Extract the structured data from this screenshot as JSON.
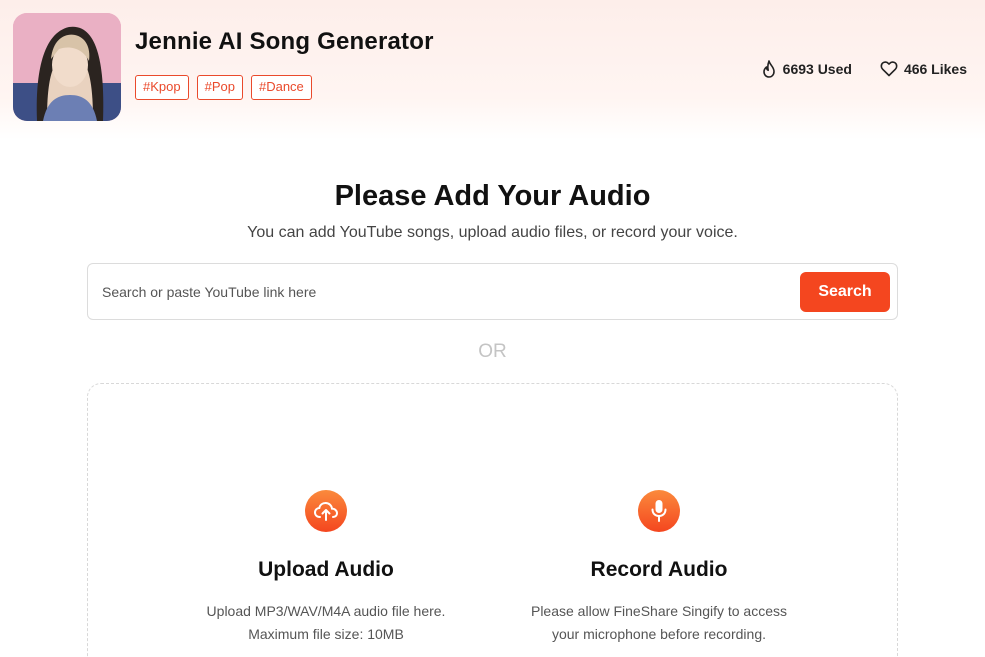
{
  "header": {
    "title": "Jennie AI Song Generator",
    "tags": [
      "#Kpop",
      "#Pop",
      "#Dance"
    ],
    "stats": {
      "used": "6693 Used",
      "likes": "466 Likes"
    },
    "icons": {
      "used": "flame-icon",
      "likes": "heart-icon"
    }
  },
  "main": {
    "title": "Please Add Your Audio",
    "subtitle": "You can add YouTube songs, upload audio files, or record your voice.",
    "search": {
      "placeholder": "Search or paste YouTube link here",
      "value": "",
      "button": "Search"
    },
    "or_label": "OR",
    "options": {
      "upload": {
        "icon": "cloud-upload-icon",
        "title": "Upload Audio",
        "desc_line1": "Upload MP3/WAV/M4A audio file here.",
        "desc_line2": "Maximum file size: 10MB"
      },
      "record": {
        "icon": "microphone-icon",
        "title": "Record Audio",
        "desc_line1": "Please allow FineShare Singify to access",
        "desc_line2": "your microphone before recording."
      }
    }
  },
  "colors": {
    "accent": "#f4461f",
    "tag_border": "#ea4a2c",
    "header_bg": "#fdeeea"
  }
}
